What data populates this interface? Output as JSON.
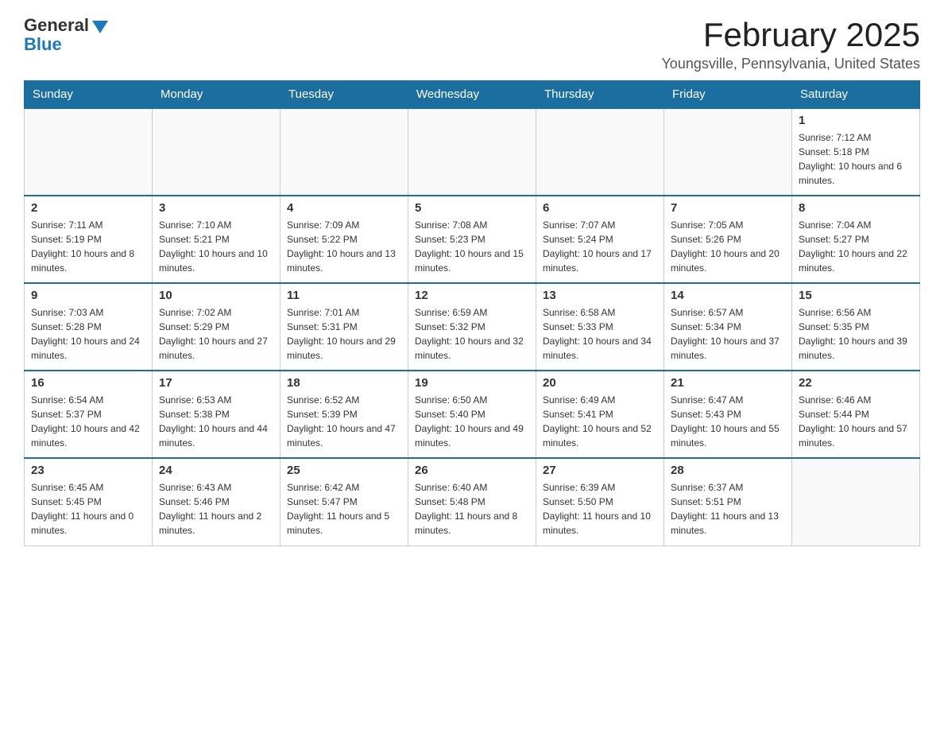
{
  "logo": {
    "general": "General",
    "blue": "Blue"
  },
  "title": "February 2025",
  "subtitle": "Youngsville, Pennsylvania, United States",
  "headers": [
    "Sunday",
    "Monday",
    "Tuesday",
    "Wednesday",
    "Thursday",
    "Friday",
    "Saturday"
  ],
  "weeks": [
    [
      {
        "day": "",
        "info": ""
      },
      {
        "day": "",
        "info": ""
      },
      {
        "day": "",
        "info": ""
      },
      {
        "day": "",
        "info": ""
      },
      {
        "day": "",
        "info": ""
      },
      {
        "day": "",
        "info": ""
      },
      {
        "day": "1",
        "info": "Sunrise: 7:12 AM\nSunset: 5:18 PM\nDaylight: 10 hours and 6 minutes."
      }
    ],
    [
      {
        "day": "2",
        "info": "Sunrise: 7:11 AM\nSunset: 5:19 PM\nDaylight: 10 hours and 8 minutes."
      },
      {
        "day": "3",
        "info": "Sunrise: 7:10 AM\nSunset: 5:21 PM\nDaylight: 10 hours and 10 minutes."
      },
      {
        "day": "4",
        "info": "Sunrise: 7:09 AM\nSunset: 5:22 PM\nDaylight: 10 hours and 13 minutes."
      },
      {
        "day": "5",
        "info": "Sunrise: 7:08 AM\nSunset: 5:23 PM\nDaylight: 10 hours and 15 minutes."
      },
      {
        "day": "6",
        "info": "Sunrise: 7:07 AM\nSunset: 5:24 PM\nDaylight: 10 hours and 17 minutes."
      },
      {
        "day": "7",
        "info": "Sunrise: 7:05 AM\nSunset: 5:26 PM\nDaylight: 10 hours and 20 minutes."
      },
      {
        "day": "8",
        "info": "Sunrise: 7:04 AM\nSunset: 5:27 PM\nDaylight: 10 hours and 22 minutes."
      }
    ],
    [
      {
        "day": "9",
        "info": "Sunrise: 7:03 AM\nSunset: 5:28 PM\nDaylight: 10 hours and 24 minutes."
      },
      {
        "day": "10",
        "info": "Sunrise: 7:02 AM\nSunset: 5:29 PM\nDaylight: 10 hours and 27 minutes."
      },
      {
        "day": "11",
        "info": "Sunrise: 7:01 AM\nSunset: 5:31 PM\nDaylight: 10 hours and 29 minutes."
      },
      {
        "day": "12",
        "info": "Sunrise: 6:59 AM\nSunset: 5:32 PM\nDaylight: 10 hours and 32 minutes."
      },
      {
        "day": "13",
        "info": "Sunrise: 6:58 AM\nSunset: 5:33 PM\nDaylight: 10 hours and 34 minutes."
      },
      {
        "day": "14",
        "info": "Sunrise: 6:57 AM\nSunset: 5:34 PM\nDaylight: 10 hours and 37 minutes."
      },
      {
        "day": "15",
        "info": "Sunrise: 6:56 AM\nSunset: 5:35 PM\nDaylight: 10 hours and 39 minutes."
      }
    ],
    [
      {
        "day": "16",
        "info": "Sunrise: 6:54 AM\nSunset: 5:37 PM\nDaylight: 10 hours and 42 minutes."
      },
      {
        "day": "17",
        "info": "Sunrise: 6:53 AM\nSunset: 5:38 PM\nDaylight: 10 hours and 44 minutes."
      },
      {
        "day": "18",
        "info": "Sunrise: 6:52 AM\nSunset: 5:39 PM\nDaylight: 10 hours and 47 minutes."
      },
      {
        "day": "19",
        "info": "Sunrise: 6:50 AM\nSunset: 5:40 PM\nDaylight: 10 hours and 49 minutes."
      },
      {
        "day": "20",
        "info": "Sunrise: 6:49 AM\nSunset: 5:41 PM\nDaylight: 10 hours and 52 minutes."
      },
      {
        "day": "21",
        "info": "Sunrise: 6:47 AM\nSunset: 5:43 PM\nDaylight: 10 hours and 55 minutes."
      },
      {
        "day": "22",
        "info": "Sunrise: 6:46 AM\nSunset: 5:44 PM\nDaylight: 10 hours and 57 minutes."
      }
    ],
    [
      {
        "day": "23",
        "info": "Sunrise: 6:45 AM\nSunset: 5:45 PM\nDaylight: 11 hours and 0 minutes."
      },
      {
        "day": "24",
        "info": "Sunrise: 6:43 AM\nSunset: 5:46 PM\nDaylight: 11 hours and 2 minutes."
      },
      {
        "day": "25",
        "info": "Sunrise: 6:42 AM\nSunset: 5:47 PM\nDaylight: 11 hours and 5 minutes."
      },
      {
        "day": "26",
        "info": "Sunrise: 6:40 AM\nSunset: 5:48 PM\nDaylight: 11 hours and 8 minutes."
      },
      {
        "day": "27",
        "info": "Sunrise: 6:39 AM\nSunset: 5:50 PM\nDaylight: 11 hours and 10 minutes."
      },
      {
        "day": "28",
        "info": "Sunrise: 6:37 AM\nSunset: 5:51 PM\nDaylight: 11 hours and 13 minutes."
      },
      {
        "day": "",
        "info": ""
      }
    ]
  ]
}
